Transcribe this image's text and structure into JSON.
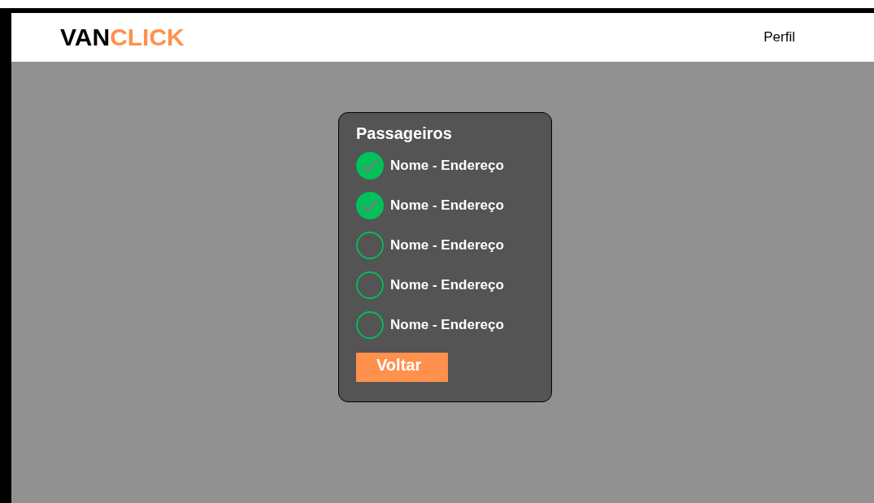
{
  "header": {
    "logo": {
      "part_1": "VAN",
      "part_2": "CLICK"
    },
    "profile_link": "Perfil"
  },
  "card": {
    "title": "Passageiros",
    "passengers": [
      {
        "label": "Nome - Endereço",
        "checked": true
      },
      {
        "label": "Nome - Endereço",
        "checked": true
      },
      {
        "label": "Nome - Endereço",
        "checked": false
      },
      {
        "label": "Nome - Endereço",
        "checked": false
      },
      {
        "label": "Nome - Endereço",
        "checked": false
      }
    ],
    "back_button": "Voltar"
  }
}
